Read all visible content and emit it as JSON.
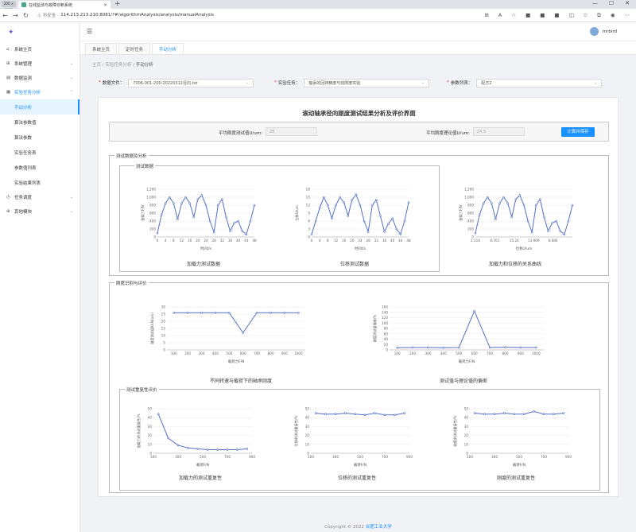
{
  "browser": {
    "profile_label": "200 × 1385",
    "tab_title": "在线监测与故障诊断系统",
    "url_warning": "不安全",
    "url": "114.213.213.210:8081/?#/algorithmAnalysis/analysis/manualAnalysis"
  },
  "sidebar": {
    "items": [
      {
        "label": "系统主页",
        "icon": "home-icon"
      },
      {
        "label": "系统管理",
        "icon": "grid-icon"
      },
      {
        "label": "数据监测",
        "icon": "chart-icon"
      },
      {
        "label": "实验任务分析",
        "icon": "task-icon"
      }
    ],
    "subitems": [
      "手动分析",
      "算法参数值",
      "算法参数",
      "实验任务表",
      "参数值列表",
      "实验结果列表"
    ],
    "items_bottom": [
      {
        "label": "任务调度",
        "icon": "clock-icon"
      },
      {
        "label": "其他模块",
        "icon": "module-icon"
      }
    ]
  },
  "header": {
    "username": "mrbird"
  },
  "page_tabs": [
    "系统主页",
    "定时任务",
    "手动分析"
  ],
  "breadcrumb": [
    "主页",
    "实验任务分析",
    "手动分析"
  ],
  "form": {
    "data_file_label": "数据文件：",
    "data_file_value": "7006-001-200-20220311径向.txt",
    "task_label": "实验任务：",
    "task_value": "轴承的回转精度与动刚度实验",
    "param_label": "参数列表：",
    "param_value": "配方2"
  },
  "panel": {
    "title": "滚动轴承径向刚度测试结果分析及评价界面",
    "avg_test_label": "平均刚度测试值U/um:",
    "avg_test_value": "28",
    "avg_theory_label": "平均刚度理论值U/um:",
    "avg_theory_value": "24.5",
    "calc_button": "计算并保存"
  },
  "sections": {
    "test_data": "测试数据及分析",
    "test_data_inner": "测试数据",
    "stiffness": "刚度识别与评价",
    "repeatability": "测试重复性评价"
  },
  "chart_data": [
    {
      "type": "line",
      "title": "加载力测试数据",
      "xlabel": "时间t/s",
      "ylabel": "加载力F/N",
      "ylim": [
        0,
        1200
      ],
      "yticks": [
        "0",
        "200",
        "400",
        "600",
        "800",
        "1,000",
        "1,200"
      ],
      "xticks": [
        "0",
        "4",
        "8",
        "12",
        "16",
        "20",
        "24",
        "28",
        "32",
        "36",
        "40",
        "44",
        "48"
      ],
      "x": [
        0,
        2,
        4,
        6,
        8,
        10,
        12,
        14,
        16,
        18,
        20,
        22,
        24,
        26,
        28,
        30,
        32,
        34,
        36,
        38,
        40,
        42,
        44,
        46,
        48
      ],
      "y": [
        100,
        550,
        850,
        1000,
        850,
        450,
        850,
        1000,
        850,
        500,
        950,
        1050,
        800,
        400,
        120,
        800,
        950,
        500,
        150,
        350,
        400,
        150,
        60,
        400,
        800
      ]
    },
    {
      "type": "line",
      "title": "位移测试数据",
      "xlabel": "时间t/s",
      "ylabel": "位移U/um",
      "ylim": [
        0,
        18
      ],
      "yticks": [
        "0",
        "3",
        "6",
        "9",
        "12",
        "15",
        "18"
      ],
      "xticks": [
        "0",
        "4",
        "8",
        "12",
        "16",
        "20",
        "24",
        "28",
        "32",
        "36",
        "40",
        "44",
        "48"
      ],
      "x": [
        0,
        2,
        4,
        6,
        8,
        10,
        12,
        14,
        16,
        18,
        20,
        22,
        24,
        26,
        28,
        30,
        32,
        34,
        36,
        38,
        40,
        42,
        44,
        46,
        48
      ],
      "y": [
        1,
        6,
        11,
        15,
        12,
        7,
        12,
        15,
        13,
        8,
        14,
        16,
        12,
        6,
        2,
        12,
        14,
        8,
        2,
        5,
        7,
        3,
        1,
        6,
        13
      ]
    },
    {
      "type": "line",
      "title": "加载力和位移的关系曲线",
      "xlabel": "位移U/um",
      "ylabel": "加载力F/N",
      "ylim": [
        0,
        1200
      ],
      "yticks": [
        "0",
        "200",
        "400",
        "600",
        "800",
        "1,000",
        "1,200"
      ],
      "xticks": [
        "2.116",
        "8.761",
        "15.24",
        "13.909",
        "6.686",
        ""
      ],
      "x": [
        0,
        1,
        2,
        3,
        4,
        5,
        6,
        7,
        8,
        9,
        10,
        11,
        12,
        13,
        14,
        15,
        16,
        17,
        18,
        19,
        20,
        21,
        22,
        23,
        24
      ],
      "y": [
        100,
        550,
        850,
        1000,
        850,
        450,
        850,
        1000,
        850,
        500,
        950,
        1050,
        800,
        400,
        120,
        800,
        950,
        500,
        150,
        350,
        400,
        150,
        60,
        400,
        800
      ]
    },
    {
      "type": "line",
      "title": "不同转速与载荷下的轴承刚度",
      "xlabel": "载荷力F/N",
      "ylabel": "刚度测试值K/(N/um)",
      "ylim": [
        0,
        30
      ],
      "yticks": [
        "0",
        "5",
        "10",
        "15",
        "20",
        "25",
        "30"
      ],
      "categories": [
        "100",
        "200",
        "300",
        "400",
        "500",
        "600",
        "700",
        "800",
        "900",
        "1000"
      ],
      "values": [
        26,
        26,
        26,
        26,
        26,
        12,
        26,
        26,
        26,
        26
      ]
    },
    {
      "type": "line",
      "title": "测试值与理论值的偏差",
      "xlabel": "载荷力F/N",
      "ylabel": "刚度测试值偏差/%",
      "ylim": [
        0,
        160
      ],
      "yticks": [
        "0",
        "20",
        "40",
        "60",
        "80",
        "100",
        "120",
        "140",
        "160"
      ],
      "categories": [
        "100",
        "200",
        "300",
        "400",
        "500",
        "600",
        "700",
        "800",
        "900",
        "1000"
      ],
      "values": [
        8,
        9,
        9,
        8,
        9,
        145,
        9,
        10,
        9,
        9
      ]
    },
    {
      "type": "line",
      "title": "加载力的测试重复性",
      "xlabel": "载荷F/N",
      "ylabel": "加载力的测试重复性/%",
      "ylim": [
        0,
        50
      ],
      "yticks": [
        "0",
        "10",
        "20",
        "30",
        "40",
        "50"
      ],
      "categories": [
        "100",
        "200",
        "300",
        "400",
        "500",
        "600",
        "700",
        "800",
        "900",
        "1000"
      ],
      "xticks": [
        "100",
        "300",
        "500",
        "700",
        "900"
      ],
      "values": [
        44,
        17,
        9,
        6,
        5,
        4,
        4,
        4,
        4,
        5
      ]
    },
    {
      "type": "line",
      "title": "位移的测试重复性",
      "xlabel": "载荷F/N",
      "ylabel": "位移的测试重复性/%",
      "ylim": [
        0,
        50
      ],
      "yticks": [
        "0",
        "10",
        "20",
        "30",
        "40",
        "50"
      ],
      "categories": [
        "100",
        "200",
        "300",
        "400",
        "500",
        "600",
        "700",
        "800",
        "900",
        "1000"
      ],
      "xticks": [
        "100",
        "300",
        "500",
        "700",
        "900"
      ],
      "values": [
        45,
        44,
        44,
        45,
        44,
        43,
        45,
        43,
        43,
        45
      ]
    },
    {
      "type": "line",
      "title": "刚度的测试重复性",
      "xlabel": "载荷F/N",
      "ylabel": "刚度的测试重复性/%",
      "ylim": [
        0,
        50
      ],
      "yticks": [
        "0",
        "10",
        "20",
        "30",
        "40",
        "50"
      ],
      "categories": [
        "100",
        "200",
        "300",
        "400",
        "500",
        "600",
        "700",
        "800",
        "900",
        "1000"
      ],
      "xticks": [
        "100",
        "300",
        "500",
        "700",
        "900"
      ],
      "values": [
        45,
        44,
        44,
        45,
        44,
        44,
        47,
        44,
        44,
        45
      ]
    }
  ],
  "footer": {
    "copyright": "Copyright © 2022",
    "org": "合肥工业大学"
  },
  "colors": {
    "accent": "#1890ff",
    "series": "#5470c6"
  }
}
